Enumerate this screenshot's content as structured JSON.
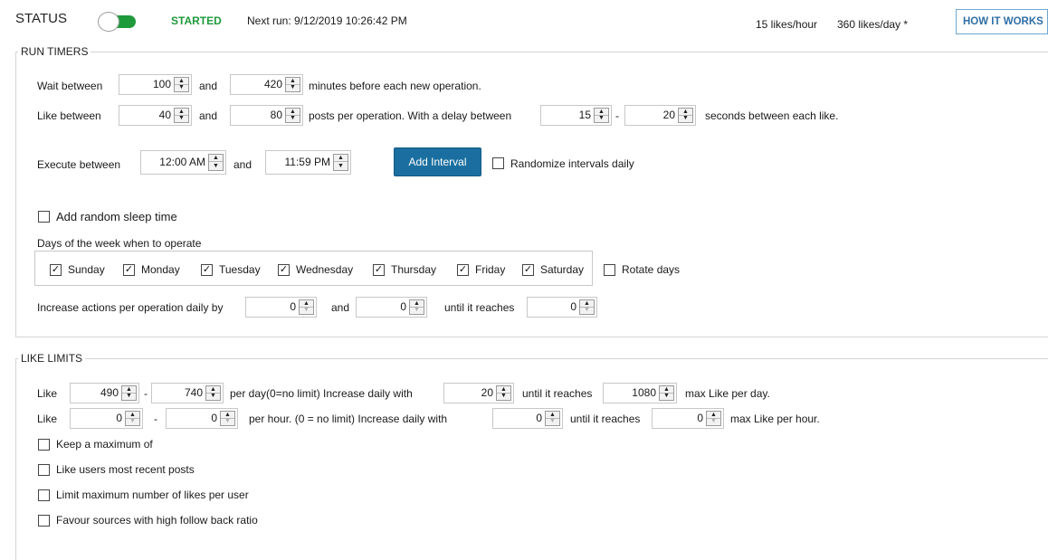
{
  "header": {
    "status_label": "STATUS",
    "toggle_on": true,
    "state_text": "STARTED",
    "next_run": "Next run: 9/12/2019 10:26:42 PM",
    "likes_per_hour": "15 likes/hour",
    "likes_per_day": "360 likes/day *",
    "how_it_works": "HOW IT WORKS"
  },
  "colors": {
    "accent_green": "#1f9a3b",
    "accent_blue": "#1b6fa0"
  },
  "run_timers": {
    "legend": "RUN TIMERS",
    "wait": {
      "label": "Wait between",
      "min": "100",
      "and": "and",
      "max": "420",
      "suffix": "minutes before each new operation."
    },
    "like": {
      "label": "Like between",
      "min": "40",
      "and": "and",
      "max": "80",
      "mid": "posts per operation.  With a delay between",
      "delay_min": "15",
      "dash": "-",
      "delay_max": "20",
      "suffix": "seconds between each like."
    },
    "execute": {
      "label": "Execute between",
      "start": "12:00 AM",
      "and": "and",
      "end": "11:59 PM",
      "add_interval": "Add Interval",
      "randomize_label": "Randomize intervals daily",
      "randomize_checked": false
    },
    "sleep": {
      "label": "Add random sleep time",
      "checked": false
    },
    "days": {
      "heading": "Days of the week when to operate",
      "items": [
        {
          "label": "Sunday",
          "checked": true
        },
        {
          "label": "Monday",
          "checked": true
        },
        {
          "label": "Tuesday",
          "checked": true
        },
        {
          "label": "Wednesday",
          "checked": true
        },
        {
          "label": "Thursday",
          "checked": true
        },
        {
          "label": "Friday",
          "checked": true
        },
        {
          "label": "Saturday",
          "checked": true
        }
      ],
      "rotate_label": "Rotate days",
      "rotate_checked": false
    },
    "increase": {
      "label": "Increase actions per operation daily by",
      "min": "0",
      "and": "and",
      "max": "0",
      "until": "until it reaches",
      "limit": "0"
    }
  },
  "like_limits": {
    "legend": "LIKE LIMITS",
    "per_day": {
      "label": "Like",
      "min": "490",
      "dash": "-",
      "max": "740",
      "mid": "per day(0=no limit)  Increase daily with",
      "increase": "20",
      "until": "until it reaches",
      "limit": "1080",
      "suffix": "max Like per day."
    },
    "per_hour": {
      "label": "Like",
      "min": "0",
      "dash": "-",
      "max": "0",
      "mid": "per hour. (0 = no limit)  Increase daily with",
      "increase": "0",
      "until": "until it reaches",
      "limit": "0",
      "suffix": "max Like per hour."
    },
    "options": [
      {
        "label": "Keep a maximum of",
        "checked": false
      },
      {
        "label": "Like users most recent posts",
        "checked": false
      },
      {
        "label": "Limit maximum number of likes per user",
        "checked": false
      },
      {
        "label": "Favour sources with high follow back ratio",
        "checked": false
      }
    ]
  }
}
